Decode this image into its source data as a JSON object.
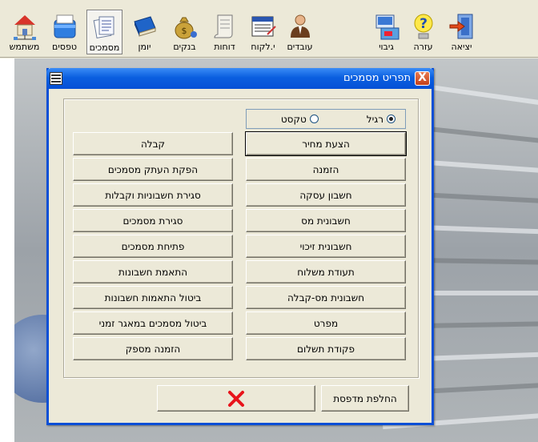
{
  "toolbar": {
    "items": [
      {
        "label": "משתמש",
        "icon": "house-network-icon"
      },
      {
        "label": "טפסים",
        "icon": "folder-box-icon"
      },
      {
        "label": "מסמכים",
        "icon": "documents-icon",
        "active": true
      },
      {
        "label": "יומן",
        "icon": "book-icon"
      },
      {
        "label": "בנקים",
        "icon": "money-bag-icon"
      },
      {
        "label": "דוחות",
        "icon": "scroll-icon"
      },
      {
        "label": "י.לקוח",
        "icon": "ledger-card-icon"
      },
      {
        "label": "עובדים",
        "icon": "employee-icon"
      },
      {
        "label": "גיבוי",
        "icon": "backup-icon"
      },
      {
        "label": "עזרה",
        "icon": "help-icon"
      },
      {
        "label": "יציאה",
        "icon": "exit-door-icon"
      }
    ]
  },
  "dialog": {
    "title": "תפריט מסמכים",
    "close_glyph": "X",
    "radio": {
      "options": [
        "רגיל",
        "טקסט"
      ],
      "selected": "רגיל"
    },
    "right_buttons": [
      "הצעת מחיר",
      "הזמנה",
      "חשבון עסקה",
      "חשבונית מס",
      "חשבונית זיכוי",
      "תעודת משלוח",
      "חשבונית מס-קבלה",
      "מפרט",
      "פקודת תשלום"
    ],
    "left_buttons": [
      "קבלה",
      "הפקת העתק מסמכים",
      "סגירת חשבוניות וקבלות",
      "סגירת מסמכים",
      "פתיחת מסמכים",
      "התאמת חשבונות",
      "ביטול התאמות חשבונות",
      "ביטול מסמכים במאגר זמני",
      "הזמנה מספק"
    ],
    "printer_button": "החלפת מדפסת",
    "cancel_icon": "red-x-icon"
  },
  "colors": {
    "title_blue": "#0550d6",
    "face": "#ece9d8",
    "cancel_red": "#e8141b"
  }
}
